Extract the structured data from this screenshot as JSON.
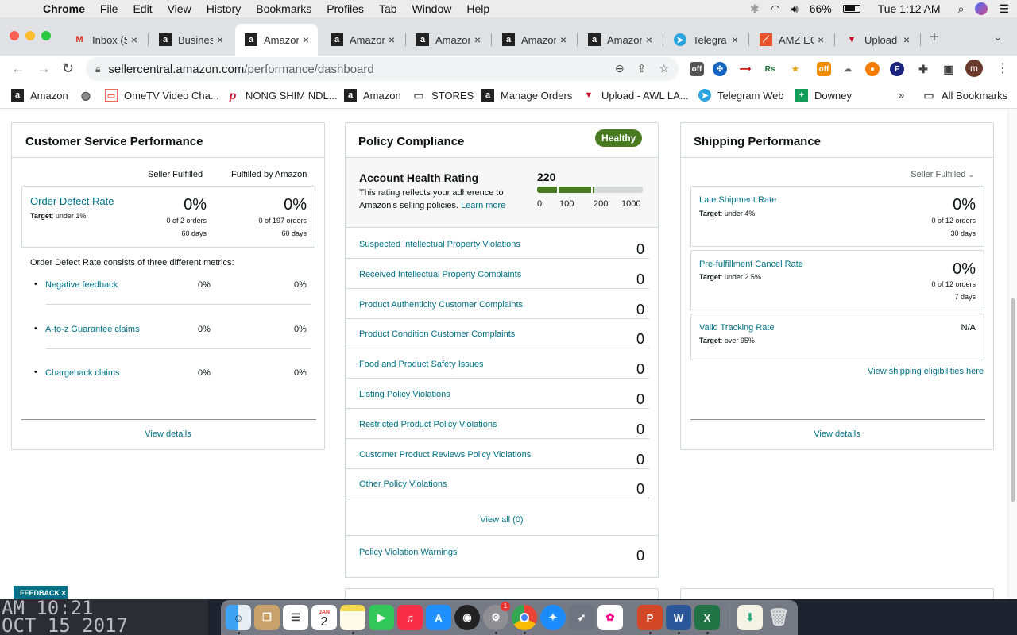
{
  "menubar": {
    "app": "Chrome",
    "items": [
      "File",
      "Edit",
      "View",
      "History",
      "Bookmarks",
      "Profiles",
      "Tab",
      "Window",
      "Help"
    ],
    "battery": "66%",
    "clock": "Tue 1:12 AM"
  },
  "tabs": [
    {
      "title": "Inbox (5",
      "icon": "gmail-icon"
    },
    {
      "title": "Busines",
      "icon": "amazon-icon"
    },
    {
      "title": "Amazon",
      "icon": "amazon-icon"
    },
    {
      "title": "Amazon",
      "icon": "amazon-icon"
    },
    {
      "title": "Amazon",
      "icon": "amazon-icon"
    },
    {
      "title": "Amazon",
      "icon": "amazon-icon"
    },
    {
      "title": "Amazon",
      "icon": "amazon-icon"
    },
    {
      "title": "Telegra",
      "icon": "telegram-icon"
    },
    {
      "title": "AMZ EC",
      "icon": "amz-ec-icon"
    },
    {
      "title": "Upload",
      "icon": "awl-icon"
    }
  ],
  "address": {
    "host": "sellercentral.amazon.com",
    "path": "/performance/dashboard"
  },
  "bookmarks": [
    {
      "label": "Amazon"
    },
    {
      "label": ""
    },
    {
      "label": "OmeTV Video Cha..."
    },
    {
      "label": "NONG SHIM NDL..."
    },
    {
      "label": "Amazon"
    },
    {
      "label": "STORES"
    },
    {
      "label": "Manage Orders"
    },
    {
      "label": "Upload - AWL LA..."
    },
    {
      "label": "Telegram Web"
    },
    {
      "label": "Downey"
    }
  ],
  "bookmarks_more": "»",
  "bookmarks_all": "All Bookmarks",
  "csp": {
    "title": "Customer Service Performance",
    "col_seller": "Seller Fulfilled",
    "col_fba": "Fulfilled by Amazon",
    "odr_label": "Order Defect Rate",
    "odr_target_label": "Target",
    "odr_target_value": ": under 1%",
    "seller_pct": "0%",
    "seller_orders": "0 of 2 orders",
    "seller_days": "60 days",
    "fba_pct": "0%",
    "fba_orders": "0 of 197 orders",
    "fba_days": "60 days",
    "consists": "Order Defect Rate consists of three different metrics:",
    "metrics": [
      {
        "label": "Negative feedback",
        "seller": "0%",
        "fba": "0%"
      },
      {
        "label": "A-to-z Guarantee claims",
        "seller": "0%",
        "fba": "0%"
      },
      {
        "label": "Chargeback claims",
        "seller": "0%",
        "fba": "0%"
      }
    ],
    "view_details": "View details"
  },
  "policy": {
    "title": "Policy Compliance",
    "badge": "Healthy",
    "ahr_title": "Account Health Rating",
    "ahr_desc_1": "This rating reflects your adherence to",
    "ahr_desc_2": "Amazon's selling policies.",
    "learn_more": "Learn more",
    "score": "220",
    "score_value": 220,
    "scale": [
      "0",
      "100",
      "200",
      "1000"
    ],
    "rows": [
      {
        "label": "Suspected Intellectual Property Violations",
        "value": "0"
      },
      {
        "label": "Received Intellectual Property Complaints",
        "value": "0"
      },
      {
        "label": "Product Authenticity Customer Complaints",
        "value": "0"
      },
      {
        "label": "Product Condition Customer Complaints",
        "value": "0"
      },
      {
        "label": "Food and Product Safety Issues",
        "value": "0"
      },
      {
        "label": "Listing Policy Violations",
        "value": "0"
      },
      {
        "label": "Restricted Product Policy Violations",
        "value": "0"
      },
      {
        "label": "Customer Product Reviews Policy Violations",
        "value": "0"
      },
      {
        "label": "Other Policy Violations",
        "value": "0"
      }
    ],
    "view_all": "View all (0)",
    "warnings_label": "Policy Violation Warnings",
    "warnings_value": "0"
  },
  "shipping": {
    "title": "Shipping Performance",
    "dropdown": "Seller Fulfilled",
    "late": {
      "label": "Late Shipment Rate",
      "target_label": "Target",
      "target": ": under 4%",
      "pct": "0%",
      "orders": "0 of 12 orders",
      "days": "30 days"
    },
    "cancel": {
      "label": "Pre-fulfillment Cancel Rate",
      "target_label": "Target",
      "target": ": under 2.5%",
      "pct": "0%",
      "orders": "0 of 12 orders",
      "days": "7 days"
    },
    "tracking": {
      "label": "Valid Tracking Rate",
      "target_label": "Target",
      "target": ": over 95%",
      "value": "N/A"
    },
    "eligibilities": "View shipping eligibilities here",
    "view_details": "View details"
  },
  "feedback": "FEEDBACK ×",
  "desktop_clock": {
    "line1": "AM 10:21",
    "line2": "OCT 15 2017"
  },
  "dock": {
    "calendar_month": "JAN",
    "calendar_day": "2",
    "badge": "1"
  }
}
